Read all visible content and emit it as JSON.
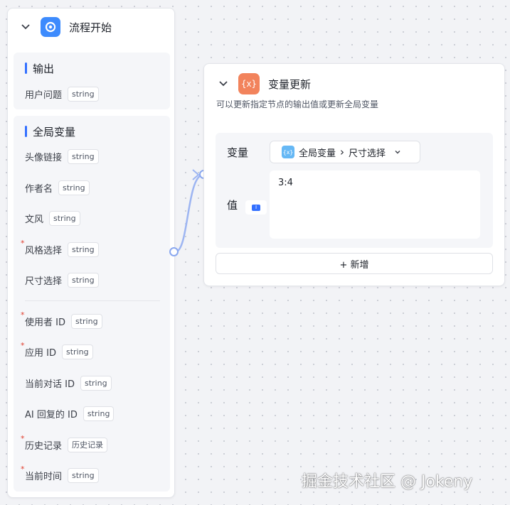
{
  "start_node": {
    "title": "流程开始",
    "output_section": {
      "title": "输出",
      "fields": [
        {
          "name": "用户问题",
          "type": "string"
        }
      ]
    },
    "global_section": {
      "title": "全局变量",
      "fields": [
        {
          "name": "头像链接",
          "type": "string",
          "required": false
        },
        {
          "name": "作者名",
          "type": "string",
          "required": false
        },
        {
          "name": "文风",
          "type": "string",
          "required": false
        },
        {
          "name": "风格选择",
          "type": "string",
          "required": true
        },
        {
          "name": "尺寸选择",
          "type": "string",
          "required": false
        }
      ],
      "system_fields": [
        {
          "name": "使用者 ID",
          "type": "string",
          "required": true
        },
        {
          "name": "应用 ID",
          "type": "string",
          "required": true
        },
        {
          "name": "当前对话 ID",
          "type": "string",
          "required": false
        },
        {
          "name": "AI 回复的 ID",
          "type": "string",
          "required": false
        },
        {
          "name": "历史记录",
          "type": "历史记录",
          "required": true
        },
        {
          "name": "当前时间",
          "type": "string",
          "required": true
        }
      ]
    },
    "required_mark": "*"
  },
  "update_node": {
    "title": "变量更新",
    "icon_text": "{x}",
    "description": "可以更新指定节点的输出值或更新全局变量",
    "variable_label": "变量",
    "variable_select": {
      "icon_text": "{x}",
      "scope": "全局变量",
      "separator": "›",
      "name": "尺寸选择"
    },
    "value_label": "值",
    "value_type_icon": "I",
    "value": "3:4",
    "add_button_label": "+ 新增"
  },
  "watermark": "掘金技术社区 @ Jokeny",
  "colors": {
    "accent": "#3370ff",
    "start_icon": "#3d8bfd",
    "update_icon": "#f2835c",
    "required": "#e03e2d",
    "edge": "#8aa8ef"
  }
}
